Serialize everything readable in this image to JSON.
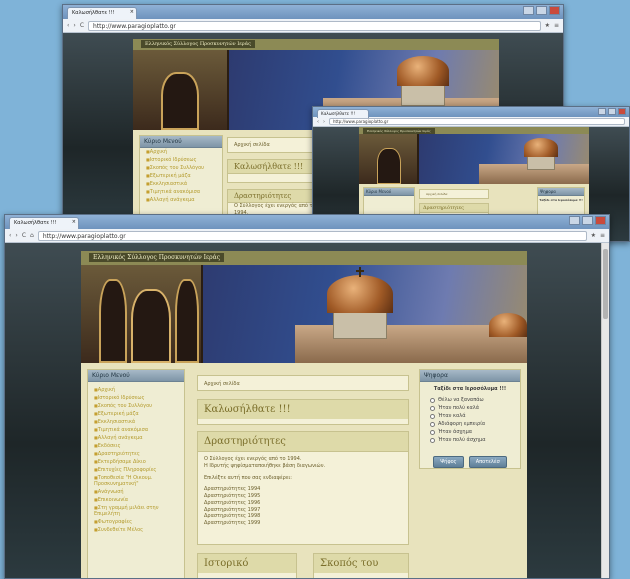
{
  "browser": {
    "tab_title": "Καλωσήλθατε !!!",
    "close_glyph": "×",
    "back_glyph": "‹",
    "forward_glyph": "›",
    "reload_glyph": "C",
    "home_glyph": "⌂",
    "url_back": "http://www.paragioplatto.gr",
    "url_mid": "http://www.paragioplatto.gr",
    "url_front": "http://www.paragioplatto.gr",
    "star_glyph": "★",
    "menu_glyph": "≡"
  },
  "site": {
    "header_text": "Ελληνικός Σύλλογος Προσκυνητών Ιεράς",
    "breadcrumb": "Αρχική σελίδα",
    "sidebar_title": "Κύριο Μενού",
    "menu_items": [
      "Αρχική",
      "Ιστορικό Ιδρύσεως",
      "Σκοπός του Συλλόγου",
      "Εξωτερική μάζα",
      "Εκκλησιαστικά",
      "Τιμητικά ανακόμισα",
      "Αλλαγή ανάγκεμα",
      "Εκδόσεις",
      "Δραστηριότητες",
      "Εκτερδήσαμε Δίκιο",
      "Επιτυχίες Πληροφορίες",
      "Τοποθεσία \"Η Οικουμ. Προσκυνηματική\"",
      "Ανάγνωσή",
      "Επικοινωνία",
      "Στη γραμμή μιλάει στην Επιμελήτη",
      "Φωτογραφίες",
      "Συνδεθείτε Μέλος"
    ],
    "welcome_title": "Καλωσήλθατε !!!",
    "activities_title": "Δραστηριότητες",
    "activities_text": [
      "Ο Σύλλογος έχει ενεργός από το 1994.",
      "Η Ιδρυτής ψηφίσματαποιήθηκε βάση διαγωνιών.",
      "",
      "Επιλέξτε αυτή που σας ενδιαφέρει:",
      "",
      "Δραστηριότητες 1994",
      "Δραστηριότητες 1995",
      "Δραστηριότητες 1996",
      "Δραστηριότητες 1997",
      "Δραστηριότητες 1998",
      "Δραστηριότητες 1999"
    ],
    "history_title": "Ιστορικό",
    "purpose_title": "Σκοπός του",
    "poll_title": "Ψηφορα",
    "poll_question": "Ταξίδι στα Ιεροσόλυμα !!!",
    "poll_options": [
      "Θέλω να ξαναπάω",
      "Ήταν πολύ καλά",
      "Ήταν καλά",
      "Αδιάφορη εμπειρία",
      "Ήταν άσχημα",
      "Ήταν πολύ άσχημα"
    ],
    "vote_button": "Ψήφος",
    "results_button": "Αποτελέσ"
  }
}
